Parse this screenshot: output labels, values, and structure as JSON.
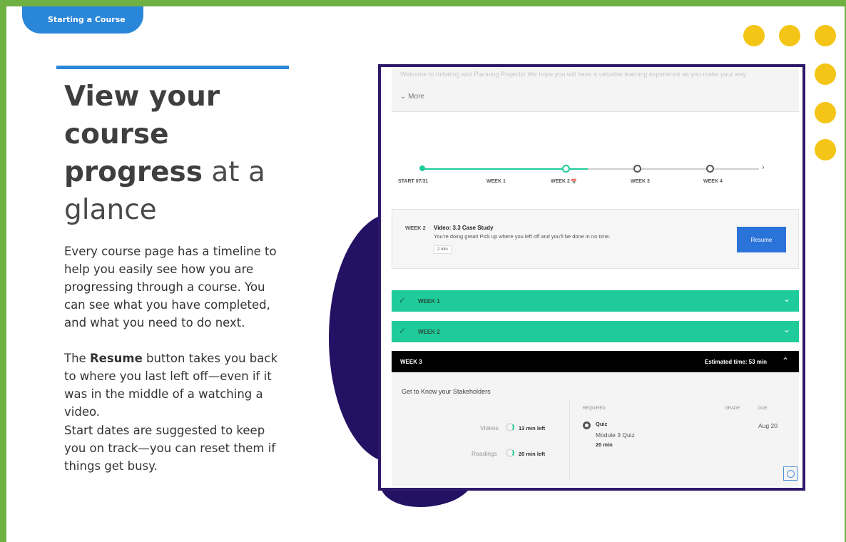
{
  "tag": {
    "label": "Starting a Course"
  },
  "headline": {
    "bold1": "View your",
    "bold2": "course",
    "bold3": "progress",
    "light1": " at a",
    "light2": "glance"
  },
  "paragraphs": {
    "p1": "Every course page has a timeline to help you easily see how you are progressing through a course. You can see what you have completed, and what you need to do next.",
    "p2_pre": "The ",
    "p2_bold": "Resume",
    "p2_post": " button takes you back to where you last left off—even if it was in the middle of a watching a video.",
    "p3": "Start dates are suggested to keep you on track—you can reset them if things get busy."
  },
  "colors": {
    "green_frame": "#6fb043",
    "blue": "#2a86d8",
    "yellow": "#f4c516",
    "purple": "#231163",
    "teal": "#1fcb9a"
  },
  "screenshot": {
    "intro_text": "Welcome to Initiating and Planning Projects! We hope you will have a valuable learning experience as you make your way",
    "more": "More",
    "timeline": {
      "labels": [
        "START 07/31",
        "WEEK 1",
        "WEEK 2",
        "WEEK 3",
        "WEEK 4"
      ],
      "calendar_icon": "📅",
      "arrow": "›"
    },
    "resume_card": {
      "week": "WEEK 2",
      "title": "Video: 3.3 Case Study",
      "subtitle": "You're doing great! Pick up where you left off and you'll be done in no time.",
      "duration": "2 min",
      "button": "Resume"
    },
    "weeks": [
      {
        "label": "WEEK 1"
      },
      {
        "label": "WEEK 2"
      }
    ],
    "week3": {
      "label": "WEEK 3",
      "estimated": "Estimated time: 53 min",
      "section_title": "Get to Know your Stakeholders",
      "videos_label": "Videos",
      "videos_left": "13 min left",
      "readings_label": "Readings",
      "readings_left": "20 min left",
      "col_required": "REQUIRED",
      "col_grade": "GRADE",
      "col_due": "DUE",
      "quiz_title": "Quiz",
      "quiz_name": "Module 3 Quiz",
      "quiz_time": "20 min",
      "quiz_due": "Aug 20"
    }
  }
}
